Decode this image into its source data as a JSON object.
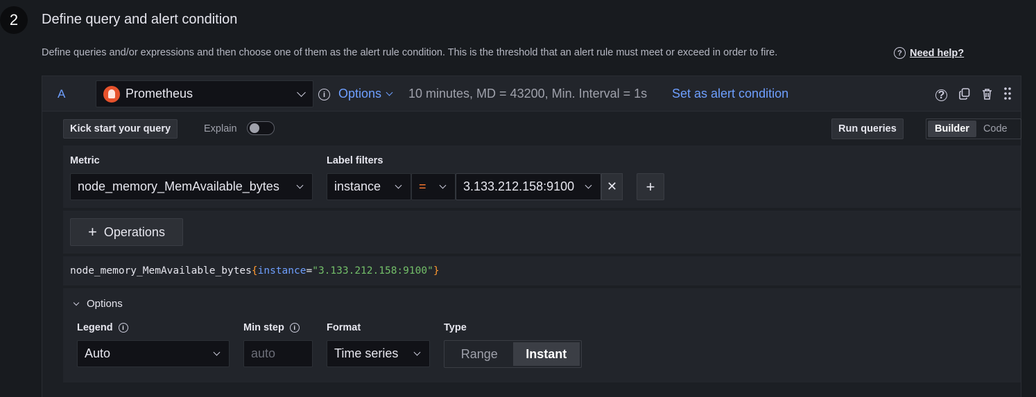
{
  "step": {
    "number": "2",
    "title": "Define query and alert condition"
  },
  "description": "Define queries and/or expressions and then choose one of them as the alert rule condition. This is the threshold that an alert rule must meet or exceed in order to fire.",
  "help": {
    "icon": "question-circle-icon",
    "label": "Need help?"
  },
  "query": {
    "ref_id": "A",
    "datasource": "Prometheus",
    "options_label": "Options",
    "options_summary": "10 minutes, MD = 43200, Min. Interval = 1s",
    "set_condition_label": "Set as alert condition",
    "icons": [
      "help-icon",
      "duplicate-icon",
      "trash-icon",
      "drag-handle-icon"
    ]
  },
  "toolbar": {
    "kick_start_label": "Kick start your query",
    "explain_label": "Explain",
    "explain_enabled": false,
    "run_label": "Run queries",
    "modes": [
      "Builder",
      "Code"
    ],
    "active_mode": "Builder"
  },
  "builder": {
    "metric_label": "Metric",
    "metric_value": "node_memory_MemAvailable_bytes",
    "label_filters_label": "Label filters",
    "filter_key": "instance",
    "filter_op": "=",
    "filter_value": "3.133.212.158:9100",
    "remove_symbol": "✕",
    "add_symbol": "+"
  },
  "operations": {
    "plus": "+",
    "label": "Operations"
  },
  "promql": {
    "metric": "node_memory_MemAvailable_bytes",
    "open": "{",
    "label": "instance",
    "eq": "=",
    "value": "\"3.133.212.158:9100\"",
    "close": "}"
  },
  "options": {
    "toggle_label": "Options",
    "legend_label": "Legend",
    "legend_value": "Auto",
    "min_step_label": "Min step",
    "min_step_placeholder": "auto",
    "format_label": "Format",
    "format_value": "Time series",
    "type_label": "Type",
    "type_options": [
      "Range",
      "Instant"
    ],
    "type_active": "Instant"
  }
}
